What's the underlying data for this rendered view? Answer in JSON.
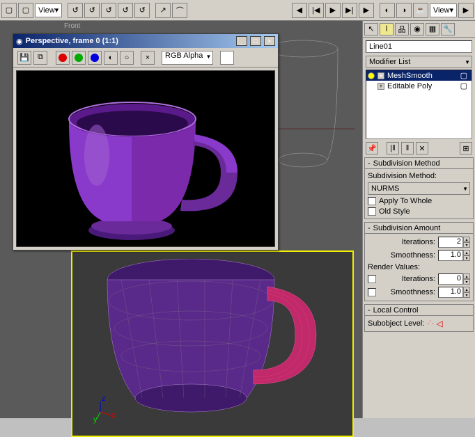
{
  "top_toolbar": {
    "view_dropdown_1": "View",
    "view_dropdown_2": "View"
  },
  "viewports": {
    "front_label": "Front"
  },
  "render_window": {
    "title": "Perspective, frame 0 (1:1)",
    "channel_dropdown": "RGB Alpha"
  },
  "right_panel": {
    "object_name": "Line01",
    "modifier_list_label": "Modifier List",
    "stack": [
      {
        "name": "MeshSmooth",
        "selected": true
      },
      {
        "name": "Editable Poly",
        "selected": false
      }
    ],
    "rollouts": {
      "subdivision_method": {
        "title": "Subdivision Method",
        "method_label": "Subdivision Method:",
        "method_value": "NURMS",
        "apply_whole": "Apply To Whole",
        "old_style": "Old Style"
      },
      "subdivision_amount": {
        "title": "Subdivision Amount",
        "iterations_label": "Iterations:",
        "iterations_value": "2",
        "smoothness_label": "Smoothness:",
        "smoothness_value": "1.0",
        "render_values_label": "Render Values:",
        "r_iter_label": "Iterations:",
        "r_iter_value": "0",
        "r_smooth_label": "Smoothness:",
        "r_smooth_value": "1.0"
      },
      "local_control": {
        "title": "Local Control",
        "subobject_label": "Subobject Level:"
      }
    }
  }
}
